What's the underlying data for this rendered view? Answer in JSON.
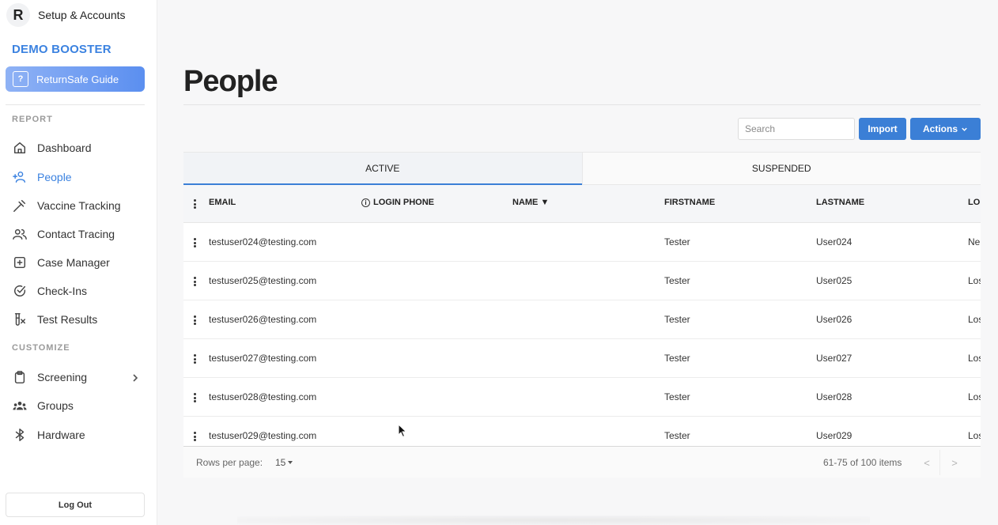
{
  "sidebar": {
    "setup_label": "Setup & Accounts",
    "logo_letter": "R",
    "org_name": "DEMO BOOSTER",
    "guide_label": "ReturnSafe Guide",
    "sections": {
      "report": "REPORT",
      "customize": "CUSTOMIZE"
    },
    "report_items": [
      {
        "label": "Dashboard",
        "icon": "home-icon"
      },
      {
        "label": "People",
        "icon": "add-person-icon",
        "active": true
      },
      {
        "label": "Vaccine Tracking",
        "icon": "syringe-icon"
      },
      {
        "label": "Contact Tracing",
        "icon": "users-icon"
      },
      {
        "label": "Case Manager",
        "icon": "plus-square-icon"
      },
      {
        "label": "Check-Ins",
        "icon": "check-circle-icon"
      },
      {
        "label": "Test Results",
        "icon": "test-tube-icon"
      }
    ],
    "customize_items": [
      {
        "label": "Screening",
        "icon": "clipboard-icon"
      },
      {
        "label": "Groups",
        "icon": "group-icon"
      },
      {
        "label": "Hardware",
        "icon": "bluetooth-icon"
      }
    ],
    "logout_label": "Log Out"
  },
  "main": {
    "title": "People",
    "search_placeholder": "Search",
    "import_label": "Import",
    "actions_label": "Actions",
    "tabs": [
      {
        "label": "ACTIVE",
        "active": true
      },
      {
        "label": "SUSPENDED",
        "active": false
      }
    ],
    "columns": [
      "EMAIL",
      "LOGIN PHONE",
      "NAME ▼",
      "FIRSTNAME",
      "LASTNAME",
      "LO"
    ],
    "rows": [
      {
        "email": "testuser024@testing.com",
        "login_phone": "",
        "name": "",
        "firstname": "Tester",
        "lastname": "User024",
        "last": "Ne"
      },
      {
        "email": "testuser025@testing.com",
        "login_phone": "",
        "name": "",
        "firstname": "Tester",
        "lastname": "User025",
        "last": "Los"
      },
      {
        "email": "testuser026@testing.com",
        "login_phone": "",
        "name": "",
        "firstname": "Tester",
        "lastname": "User026",
        "last": "Los"
      },
      {
        "email": "testuser027@testing.com",
        "login_phone": "",
        "name": "",
        "firstname": "Tester",
        "lastname": "User027",
        "last": "Los"
      },
      {
        "email": "testuser028@testing.com",
        "login_phone": "",
        "name": "",
        "firstname": "Tester",
        "lastname": "User028",
        "last": "Los"
      },
      {
        "email": "testuser029@testing.com",
        "login_phone": "",
        "name": "",
        "firstname": "Tester",
        "lastname": "User029",
        "last": "Los"
      }
    ],
    "footer": {
      "rows_per_page_label": "Rows per page:",
      "rows_per_page_value": "15",
      "items_range": "61-75 of 100 items",
      "prev": "<",
      "next": ">"
    }
  },
  "colors": {
    "accent": "#3b7fd6",
    "org": "#3b82e0"
  }
}
